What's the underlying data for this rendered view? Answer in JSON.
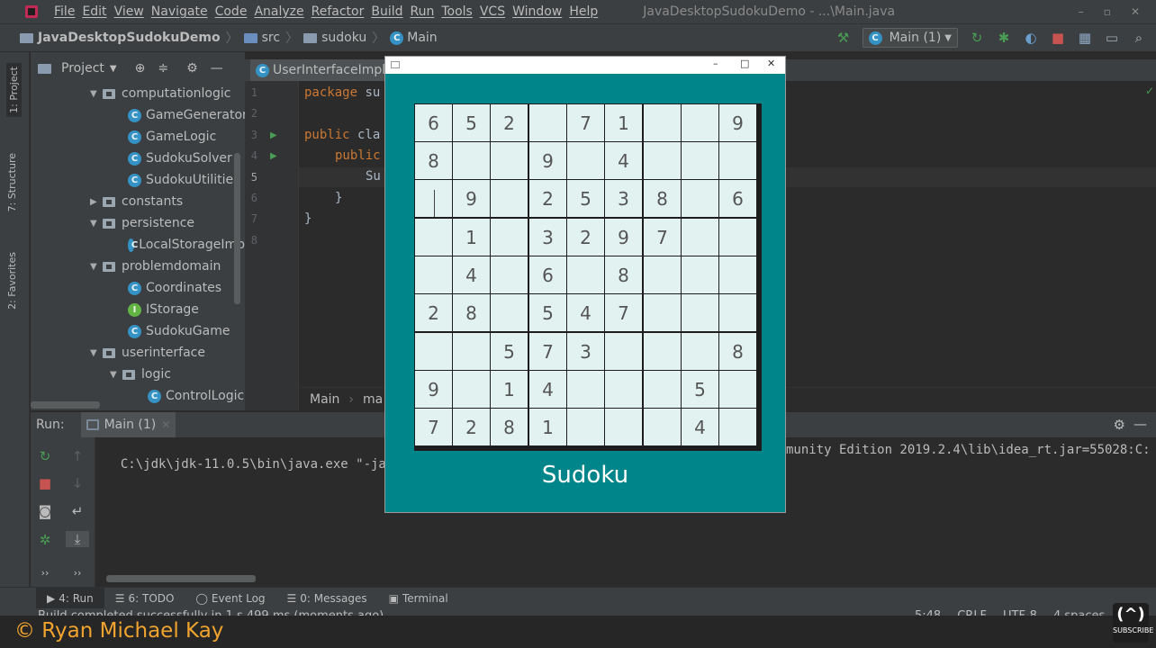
{
  "menubar": {
    "items": [
      "File",
      "Edit",
      "View",
      "Navigate",
      "Code",
      "Analyze",
      "Refactor",
      "Build",
      "Run",
      "Tools",
      "VCS",
      "Window",
      "Help"
    ],
    "window_title": "JavaDesktopSudokuDemo - ...\\Main.java"
  },
  "navbar": {
    "project": "JavaDesktopSudokuDemo",
    "src": "src",
    "package": "sudoku",
    "file": "Main",
    "run_config": "Main (1)"
  },
  "left_stripe": {
    "project_tab": "1: Project",
    "structure_tab": "7: Structure",
    "favorites_tab": "2: Favorites"
  },
  "project_panel": {
    "title": "Project",
    "tree": [
      {
        "label": "computationlogic",
        "kind": "package",
        "expanded": true
      },
      {
        "label": "GameGenerator",
        "kind": "class"
      },
      {
        "label": "GameLogic",
        "kind": "class"
      },
      {
        "label": "SudokuSolver",
        "kind": "class"
      },
      {
        "label": "SudokuUtilities",
        "kind": "class"
      },
      {
        "label": "constants",
        "kind": "package",
        "expanded": false
      },
      {
        "label": "persistence",
        "kind": "package",
        "expanded": true
      },
      {
        "label": "LocalStorageImp",
        "kind": "class"
      },
      {
        "label": "problemdomain",
        "kind": "package",
        "expanded": true
      },
      {
        "label": "Coordinates",
        "kind": "class"
      },
      {
        "label": "IStorage",
        "kind": "interface"
      },
      {
        "label": "SudokuGame",
        "kind": "class"
      },
      {
        "label": "userinterface",
        "kind": "package",
        "expanded": true
      },
      {
        "label": "logic",
        "kind": "package",
        "expanded": true
      },
      {
        "label": "ControlLogic",
        "kind": "class"
      }
    ]
  },
  "editor": {
    "tab": "UserInterfaceImpl.",
    "line_numbers": [
      "1",
      "2",
      "3",
      "4",
      "5",
      "6",
      "7",
      "8"
    ],
    "code": {
      "l1_kw": "package",
      "l1_rest": " su",
      "l3_kw": "public",
      "l3_rest": " cla",
      "l4_kw": "public",
      "l5": "Su",
      "l6": "}",
      "l7": "}"
    },
    "breadcrumb": [
      "Main",
      "ma"
    ]
  },
  "run_panel": {
    "label": "Run:",
    "tab": "Main (1)",
    "console_left": "C:\\jdk\\jdk-11.0.5\\bin\\java.exe \"-jav",
    "console_right": "munity Edition 2019.2.4\\lib\\idea_rt.jar=55028:C:"
  },
  "bottom_tabs": [
    {
      "label": "4: Run"
    },
    {
      "label": "6: TODO"
    },
    {
      "label": "Event Log"
    },
    {
      "label": "0: Messages"
    },
    {
      "label": "Terminal"
    }
  ],
  "statusbar": {
    "message": "Build completed successfully in 1 s 499 ms (moments ago)",
    "right": [
      "5:48",
      "CRLF",
      "UTF-8",
      "4 spaces"
    ]
  },
  "watermark": {
    "text": "© Ryan Michael Kay",
    "subscribe": "SUBSCRIBE"
  },
  "sudoku": {
    "title": "Sudoku",
    "grid": [
      [
        "6",
        "5",
        "2",
        "",
        "7",
        "1",
        "",
        "",
        "9"
      ],
      [
        "8",
        "",
        "",
        "9",
        "",
        "4",
        "",
        "",
        ""
      ],
      [
        "",
        "9",
        "",
        "2",
        "5",
        "3",
        "8",
        "",
        "6"
      ],
      [
        "",
        "1",
        "",
        "3",
        "2",
        "9",
        "7",
        "",
        ""
      ],
      [
        "",
        "4",
        "",
        "6",
        "",
        "8",
        "",
        "",
        ""
      ],
      [
        "2",
        "8",
        "",
        "5",
        "4",
        "7",
        "",
        "",
        ""
      ],
      [
        "",
        "",
        "5",
        "7",
        "3",
        "",
        "",
        "",
        "8"
      ],
      [
        "9",
        "",
        "1",
        "4",
        "",
        "",
        "",
        "5",
        ""
      ],
      [
        "7",
        "2",
        "8",
        "1",
        "",
        "",
        "",
        "4",
        ""
      ]
    ]
  }
}
